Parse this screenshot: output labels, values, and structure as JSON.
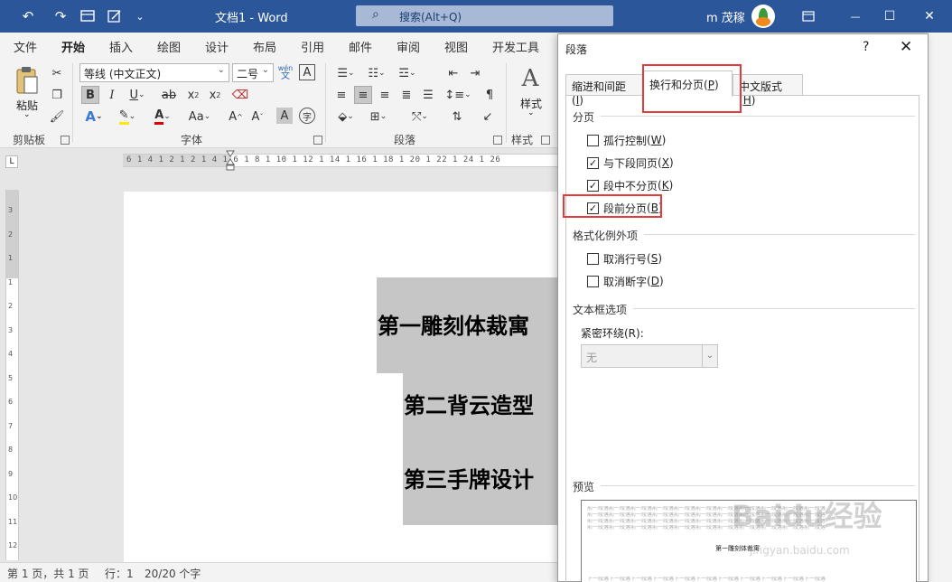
{
  "titlebar": {
    "doc_title": "文档1 - Word",
    "search_placeholder": "搜索(Alt+Q)",
    "user_name": "m 茂稼",
    "undo_glyph": "↶",
    "redo_glyph": "↷",
    "minimize_glyph": "—",
    "restore_glyph": "☐",
    "close_glyph": "✕"
  },
  "ribbon_tabs": [
    "文件",
    "开始",
    "插入",
    "绘图",
    "设计",
    "布局",
    "引用",
    "邮件",
    "审阅",
    "视图",
    "开发工具"
  ],
  "ribbon": {
    "paste_label": "粘贴",
    "font_name": "等线 (中文正文)",
    "font_size": "二号",
    "phonetic_top": "wén",
    "phonetic_bottom": "文",
    "styles_label": "样式",
    "groups": {
      "clipboard": "剪贴板",
      "font": "字体",
      "paragraph": "段落",
      "styles": "样式"
    }
  },
  "ruler": {
    "h_ticks": "6 1 4 1 2 1   2 1 4 1 6 1 8 1 10 1 12 1 14 1 16 1 18 1 20 1 22 1 24 1 26",
    "v_ticks": [
      "3",
      "2",
      "1",
      "1",
      "2",
      "3",
      "4",
      "5",
      "6",
      "7",
      "8",
      "9",
      "10",
      "11",
      "12"
    ]
  },
  "document": {
    "paragraphs": [
      "第一雕刻体裁寓",
      "第二背云造型",
      "第三手牌设计"
    ]
  },
  "statusbar": {
    "page": "第 1 页，共 1 页",
    "row": "行：1",
    "words": "20/20 个字"
  },
  "dialog": {
    "title": "段落",
    "help": "?",
    "close": "✕",
    "tabs": [
      {
        "label": "缩进和间距",
        "key": "I"
      },
      {
        "label": "换行和分页",
        "key": "P"
      },
      {
        "label": "中文版式",
        "key": "H"
      }
    ],
    "sections": {
      "pagination": "分页",
      "exceptions": "格式化例外项",
      "textbox": "文本框选项",
      "preview": "预览"
    },
    "checkboxes": [
      {
        "label": "孤行控制",
        "key": "W",
        "checked": false
      },
      {
        "label": "与下段同页",
        "key": "X",
        "checked": true
      },
      {
        "label": "段中不分页",
        "key": "K",
        "checked": true
      },
      {
        "label": "段前分页",
        "key": "B",
        "checked": true
      },
      {
        "label": "取消行号",
        "key": "S",
        "checked": false
      },
      {
        "label": "取消断字",
        "key": "D",
        "checked": false
      }
    ],
    "wrap_label": "紧密环绕(R):",
    "wrap_value": "无",
    "preview_title": "第一雕刻体裁寓",
    "preview_filler_before": "前一段落前一段落前一段落前一段落前一段落前一段落前一段落前一段落前一段落前一段落前一段落",
    "preview_filler_after": "下一段落下一段落下一段落下一段落下一段落下一段落下一段落下一段落下一段落下一段落下一段落"
  },
  "watermark": {
    "logo": "Baidu经验",
    "url": "jingyan.baidu.com"
  },
  "colors": {
    "title_bar": "#2b579a",
    "highlight": "#e03c3c",
    "selection_bg": "#c6c6c6"
  }
}
